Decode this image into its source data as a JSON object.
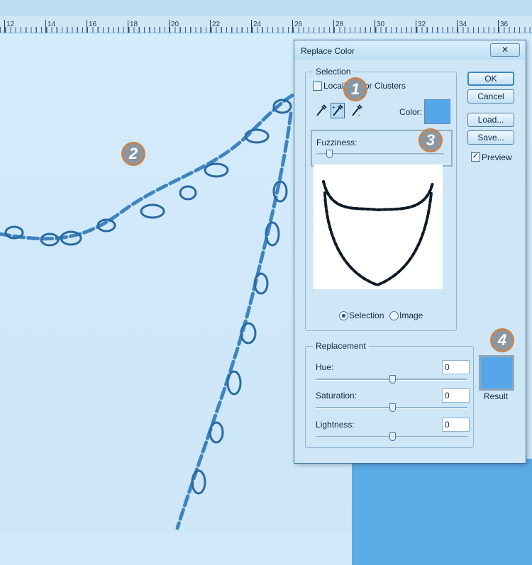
{
  "ruler": {
    "numbers": [
      "12",
      "14",
      "16",
      "18",
      "20",
      "22",
      "24",
      "26",
      "28",
      "30",
      "32",
      "34",
      "36"
    ]
  },
  "markers": [
    "1",
    "2",
    "3",
    "4"
  ],
  "dialog": {
    "title": "Replace Color",
    "close_glyph": "✕",
    "selection": {
      "group_label": "Selection",
      "localized_label_part1": "Locali",
      "localized_label_part2": "or Clusters",
      "color_label": "Color:",
      "swatch_color": "#55a7ea",
      "fuzziness_label": "Fuzziness:",
      "fuzziness_value": 0.1,
      "radio_selection": "Selection",
      "radio_image": "Image"
    },
    "buttons": {
      "ok": "OK",
      "cancel": "Cancel",
      "load": "Load...",
      "save": "Save..."
    },
    "preview_label": "Preview",
    "replacement": {
      "group_label": "Replacement",
      "hue_label": "Hue:",
      "hue_value": "0",
      "saturation_label": "Saturation:",
      "saturation_value": "0",
      "lightness_label": "Lightness:",
      "lightness_value": "0",
      "result_label": "Result",
      "result_color": "#55a7ea"
    }
  },
  "colors": {
    "canvas": "#cfe9fb",
    "chain": "#3f84bf",
    "marker_border": "#e07b2d"
  }
}
